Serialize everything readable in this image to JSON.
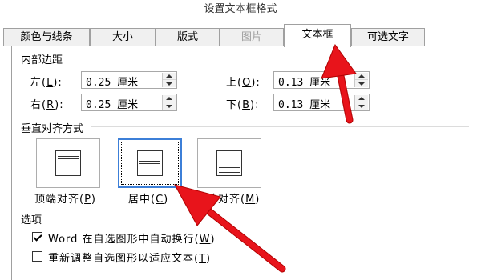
{
  "window": {
    "title": "设置文本框格式"
  },
  "tabs": [
    {
      "label": "颜色与线条",
      "state": "normal"
    },
    {
      "label": "大小",
      "state": "normal"
    },
    {
      "label": "版式",
      "state": "normal"
    },
    {
      "label": "图片",
      "state": "disabled"
    },
    {
      "label": "文本框",
      "state": "active"
    },
    {
      "label": "可选文字",
      "state": "normal"
    }
  ],
  "margins": {
    "section_title": "内部边距",
    "left": {
      "label_pre": "左(",
      "key": "L",
      "label_post": "):",
      "value": "0.25 厘米"
    },
    "right": {
      "label_pre": "右(",
      "key": "R",
      "label_post": "):",
      "value": "0.25 厘米"
    },
    "top": {
      "label_pre": "上(",
      "key": "O",
      "label_post": "):",
      "value": "0.13 厘米"
    },
    "bottom": {
      "label_pre": "下(",
      "key": "B",
      "label_post": "):",
      "value": "0.13 厘米"
    }
  },
  "vertical_align": {
    "section_title": "垂直对齐方式",
    "options": [
      {
        "label_pre": "顶端对齐(",
        "key": "P",
        "label_post": ")",
        "selected": false
      },
      {
        "label_pre": "居中(",
        "key": "C",
        "label_post": ")",
        "selected": true
      },
      {
        "label_pre": "底端对齐(",
        "key": "M",
        "label_post": ")",
        "selected": false
      }
    ]
  },
  "options": {
    "section_title": "选项",
    "word_wrap": {
      "label_pre": "Word 在自选图形中自动换行(",
      "key": "W",
      "label_post": ")",
      "checked": true
    },
    "resize": {
      "label_pre": "重新调整自选图形以适应文本(",
      "key": "T",
      "label_post": ")",
      "checked": false
    }
  },
  "colors": {
    "arrow": "#e8141b",
    "selection": "#3c7fd8",
    "border": "#a0a0a0"
  },
  "icons": {
    "spin_up": "triangle-up-icon",
    "spin_down": "triangle-down-icon",
    "checkmark": "checkmark-icon"
  }
}
